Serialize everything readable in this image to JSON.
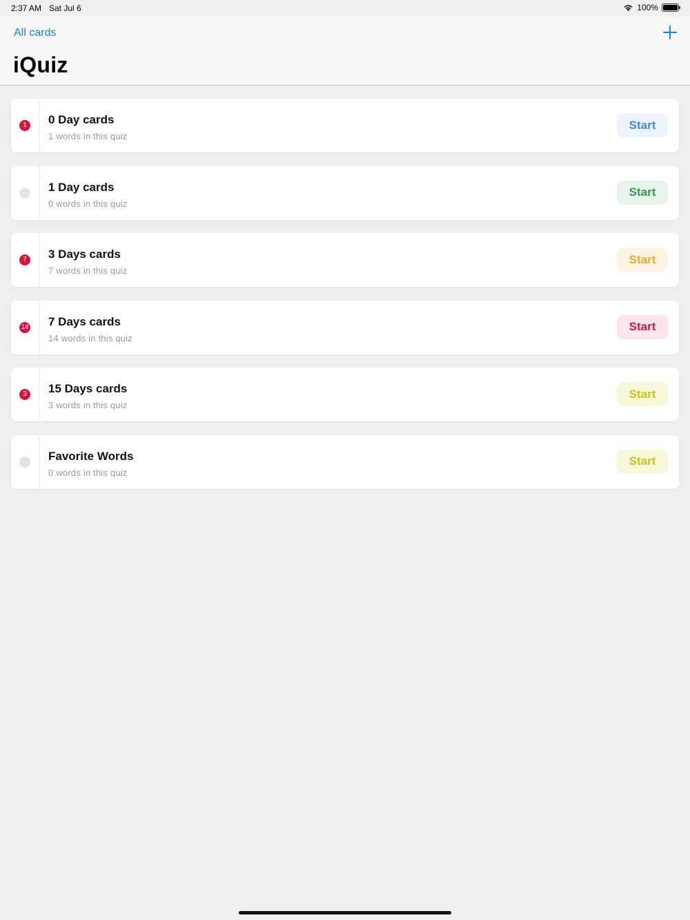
{
  "status_bar": {
    "time": "2:37 AM",
    "date": "Sat Jul 6",
    "battery": "100%",
    "wifi_icon": "wifi-icon",
    "battery_icon": "battery-icon"
  },
  "header": {
    "back_label": "All cards",
    "title": "iQuiz",
    "add_icon": "plus-icon"
  },
  "quizzes": [
    {
      "title": "0 Day cards",
      "subtitle": "1 words in this quiz",
      "badge": "1",
      "start_label": "Start",
      "accent": "#4a8ad9",
      "accent_bg": "#edf3fb"
    },
    {
      "title": "1 Day cards",
      "subtitle": "0 words in this quiz",
      "badge": "",
      "start_label": "Start",
      "accent": "#2f9e4f",
      "accent_bg": "#e7f4ea"
    },
    {
      "title": "3 Days cards",
      "subtitle": "7 words in this quiz",
      "badge": "7",
      "start_label": "Start",
      "accent": "#f0a630",
      "accent_bg": "#fdf3e3"
    },
    {
      "title": "7 Days cards",
      "subtitle": "14 words in this quiz",
      "badge": "14",
      "start_label": "Start",
      "accent": "#d8163c",
      "accent_bg": "#fbe5e9"
    },
    {
      "title": "15 Days cards",
      "subtitle": "3 words in this quiz",
      "badge": "3",
      "start_label": "Start",
      "accent": "#c8c31b",
      "accent_bg": "#f8f7d9"
    },
    {
      "title": "Favorite Words",
      "subtitle": "0 words in this quiz",
      "badge": "",
      "start_label": "Start",
      "accent": "#c8c31b",
      "accent_bg": "#f8f7d9"
    }
  ]
}
